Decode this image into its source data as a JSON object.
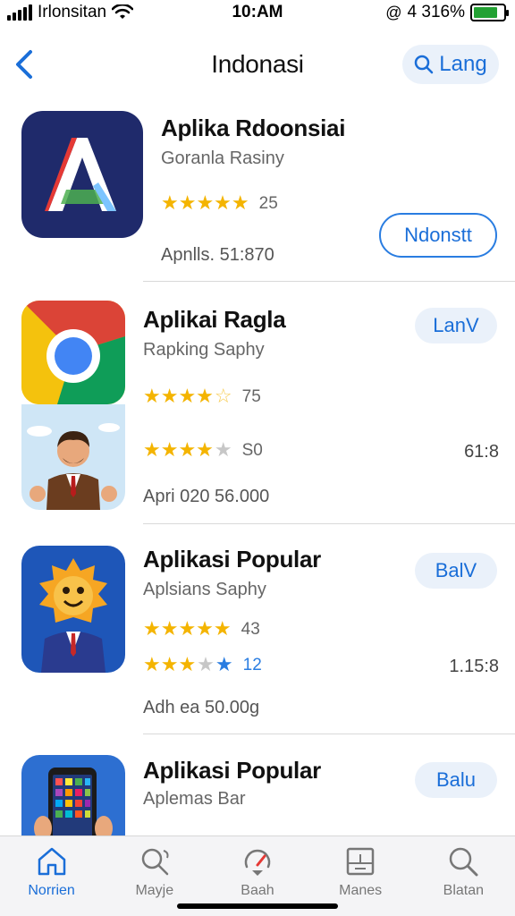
{
  "status_bar": {
    "carrier": "Irlonsitan",
    "time": "10:AM",
    "battery_text": "4 316%",
    "battery_level": 0.8
  },
  "nav": {
    "back_icon": "chevron-left-icon",
    "title": "Indonasi",
    "lang_label": "Lang",
    "lang_icon": "search-icon"
  },
  "apps": [
    {
      "name": "Aplika Rdoonsiai",
      "subtitle": "Goranla Rasiny",
      "rating": 5,
      "rating_count": "25",
      "meta": "Apnlls.  51:870",
      "action_label": "Ndonstt"
    },
    {
      "name": "Aplikai Ragla",
      "subtitle": "Rapking Saphy",
      "rating": 4.5,
      "rating_count": "75",
      "rating2": 3.5,
      "rating2_count": "S0",
      "meta": "Apri 020  56.000",
      "right_meta": "61:8",
      "action_label": "LanV"
    },
    {
      "name": "Aplikasi Popular",
      "subtitle": "Aplsians Saphy",
      "rating": 5,
      "rating_count": "43",
      "rating2": 4,
      "rating2_count": "12",
      "meta": "Adh ea  50.00g",
      "right_meta": "1.15:8",
      "action_label": "BalV"
    },
    {
      "name": "Aplikasi Popular",
      "subtitle": "Aplemas Bar",
      "action_label": "Balu"
    }
  ],
  "tabs": [
    {
      "label": "Norrien",
      "icon": "home-icon",
      "active": true
    },
    {
      "label": "Mayje",
      "icon": "search-leaf-icon",
      "active": false
    },
    {
      "label": "Baah",
      "icon": "gauge-icon",
      "active": false
    },
    {
      "label": "Manes",
      "icon": "document-icon",
      "active": false
    },
    {
      "label": "Blatan",
      "icon": "search-icon",
      "active": false
    }
  ],
  "colors": {
    "accent": "#1a6ed8",
    "star": "#f4b400",
    "tab_bg": "#f4f4f6"
  }
}
